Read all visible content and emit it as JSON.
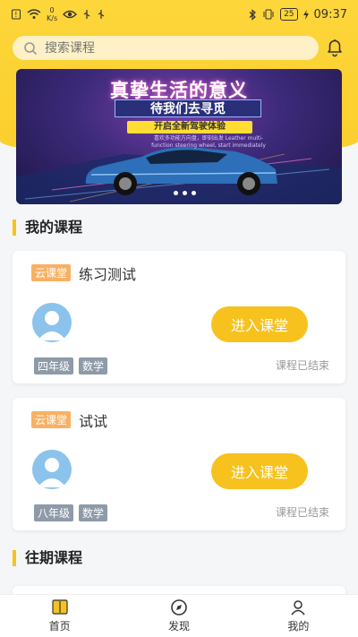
{
  "status_bar": {
    "net_speed": "0",
    "net_unit": "K/s",
    "battery": "25",
    "time": "09:37"
  },
  "search": {
    "placeholder": "搜索课程"
  },
  "banner": {
    "headline": "真挚生活的意义",
    "subheadline": "待我们去寻觅",
    "tagline": "开启全新驾驶体验",
    "small_text": "喜欢多功能方向盘，即刻出发 Leather multi-function steering wheel, start immediately"
  },
  "my_courses": {
    "title": "我的课程",
    "items": [
      {
        "tag": "云课堂",
        "name": "练习测试",
        "button": "进入课堂",
        "chips": [
          "四年级",
          "数学"
        ],
        "status": "课程已结束"
      },
      {
        "tag": "云课堂",
        "name": "试试",
        "button": "进入课堂",
        "chips": [
          "八年级",
          "数学"
        ],
        "status": "课程已结束"
      }
    ]
  },
  "past_courses": {
    "title": "往期课程"
  },
  "tabbar": {
    "items": [
      {
        "label": "首页",
        "icon": "book-icon"
      },
      {
        "label": "发现",
        "icon": "compass-icon"
      },
      {
        "label": "我的",
        "icon": "user-icon"
      }
    ]
  },
  "colors": {
    "accent": "#f7c21d",
    "tag": "#f8b163",
    "chip": "#8e9aa8"
  }
}
